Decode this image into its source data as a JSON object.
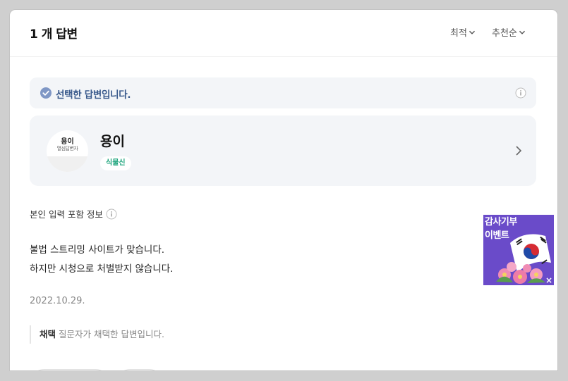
{
  "header": {
    "answer_count": "1 개 답변",
    "sort_latest": "최적",
    "sort_recommend": "추천순"
  },
  "selected_banner": {
    "text": "선택한 답변입니다."
  },
  "profile": {
    "name": "용이",
    "badge": "식물신",
    "avatar_name": "용이",
    "avatar_sub": "열심답변자"
  },
  "answer": {
    "self_input_label": "본인 입력 포함 정보",
    "lines": [
      "불법 스트리밍 사이트가 맞습니다.",
      "하지만 시청으로 처벌받지 않습니다."
    ],
    "date": "2022.10.29."
  },
  "adopt": {
    "label": "채택",
    "text": "질문자가 채택한 답변입니다."
  },
  "ad": {
    "title_line1": "감사기부",
    "title_line2": "이벤트",
    "close": "×"
  },
  "colors": {
    "accent_blue": "#3a5a8c",
    "badge_green": "#1aa37a",
    "ad_purple": "#6a4bc9"
  },
  "icons": {
    "check": "check-circle-icon",
    "info": "info-icon",
    "chevron_down": "chevron-down-icon",
    "chevron_right": "chevron-right-icon"
  }
}
